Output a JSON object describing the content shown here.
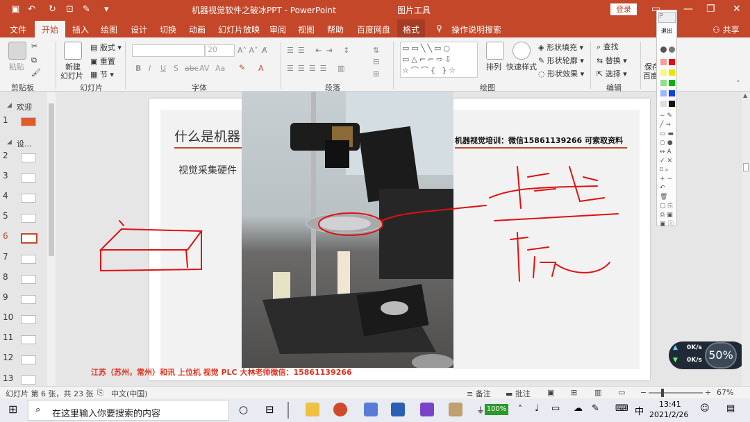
{
  "titlebar": {
    "title": "机器视觉软件之破冰PPT  -  PowerPoint",
    "tools_label": "图片工具",
    "login": "登录",
    "colors": {
      "bar": "#c4472a"
    }
  },
  "tabs": [
    "文件",
    "开始",
    "插入",
    "绘图",
    "设计",
    "切换",
    "动画",
    "幻灯片放映",
    "审阅",
    "视图",
    "帮助",
    "百度网盘",
    "格式"
  ],
  "active_tab": "开始",
  "tell_me": "操作说明搜索",
  "share": "共享",
  "ribbon": {
    "clipboard": {
      "paste": "粘贴",
      "label": "剪贴板"
    },
    "slides": {
      "new_slide_1": "新建",
      "new_slide_2": "幻灯片",
      "layout": "版式",
      "reset": "重置",
      "section": "节",
      "label": "幻灯片"
    },
    "font": {
      "size": "20",
      "label": "字体",
      "buttons": [
        "B",
        "I",
        "U",
        "S",
        "abc",
        "AV",
        "Aa",
        "A"
      ]
    },
    "paragraph": {
      "label": "段落"
    },
    "drawing": {
      "arrange": "排列",
      "quick_styles": "快速样式",
      "fill": "形状填充",
      "outline": "形状轮廓",
      "effects": "形状效果",
      "label": "绘图"
    },
    "editing": {
      "find": "查找",
      "replace": "替换",
      "select": "选择",
      "label": "编辑"
    },
    "save": {
      "line1": "保存",
      "line2": "百度"
    }
  },
  "thumbnails": {
    "section1": "欢迎",
    "section2": "设...",
    "numbers": [
      "1",
      "2",
      "3",
      "4",
      "5",
      "6",
      "7",
      "8",
      "9",
      "10",
      "11",
      "12",
      "13"
    ],
    "active": "6"
  },
  "slide": {
    "title": "什么是机器",
    "subtitle": "视觉采集硬件",
    "header_right": "机器视觉培训：微信15861139266 可索取资料",
    "footer": "江苏（苏州，常州）和讯 上位机  视觉  PLC 大林老师微信：15861139266"
  },
  "pen_toolbar": {
    "close_label": "退出",
    "title": "P"
  },
  "netmeter": {
    "up": "0K/s",
    "down": "0K/s",
    "percent": "50%"
  },
  "status": {
    "slide_info": "幻灯片 第 6 张，共 23 张",
    "language": "中文(中国)",
    "notes": "备注",
    "comments": "批注",
    "zoom": "67%"
  },
  "taskbar": {
    "search_placeholder": "在这里输入你要搜索的内容",
    "battery": "100%",
    "ime": "中",
    "time": "13:41",
    "date": "2021/2/26"
  }
}
